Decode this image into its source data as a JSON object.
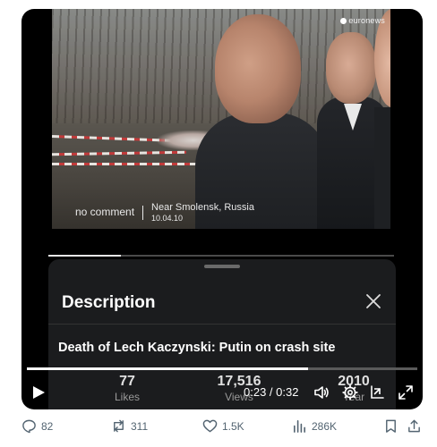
{
  "video": {
    "brand": "euronews",
    "caption_left": "no comment",
    "caption_location": "Near Smolensk, Russia",
    "caption_date": "10.04.10",
    "progress_fraction": 0.72
  },
  "sheet": {
    "title": "Description",
    "description": "Death of Lech Kaczynski: Putin on crash site",
    "stats": [
      {
        "value": "77",
        "label": "Likes"
      },
      {
        "value": "17,516",
        "label": "Views"
      },
      {
        "value": "2010",
        "label": "Year"
      }
    ]
  },
  "controls": {
    "time": "0:23 / 0:32",
    "progress_fraction": 0.72
  },
  "actions": {
    "replies": "82",
    "reposts": "311",
    "likes": "1.5K",
    "views": "286K"
  },
  "colors": {
    "action_gray": "#536471",
    "sheet_bg": "#1b1c1e"
  }
}
